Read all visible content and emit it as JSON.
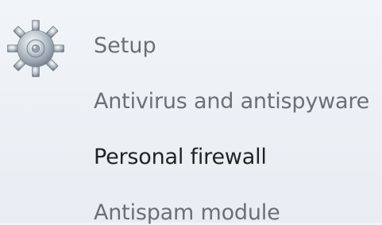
{
  "menu": {
    "section_title": "Setup",
    "icon": "gear-icon",
    "items": [
      {
        "label": "Antivirus and antispyware",
        "state": "normal"
      },
      {
        "label": "Personal firewall",
        "state": "highlighted"
      },
      {
        "label": "Antispam module",
        "state": "normal"
      }
    ]
  },
  "colors": {
    "background": "#edf1f6",
    "muted_text": "#6b6f76",
    "active_text": "#202326",
    "gear_base": "#9aa4ad"
  }
}
